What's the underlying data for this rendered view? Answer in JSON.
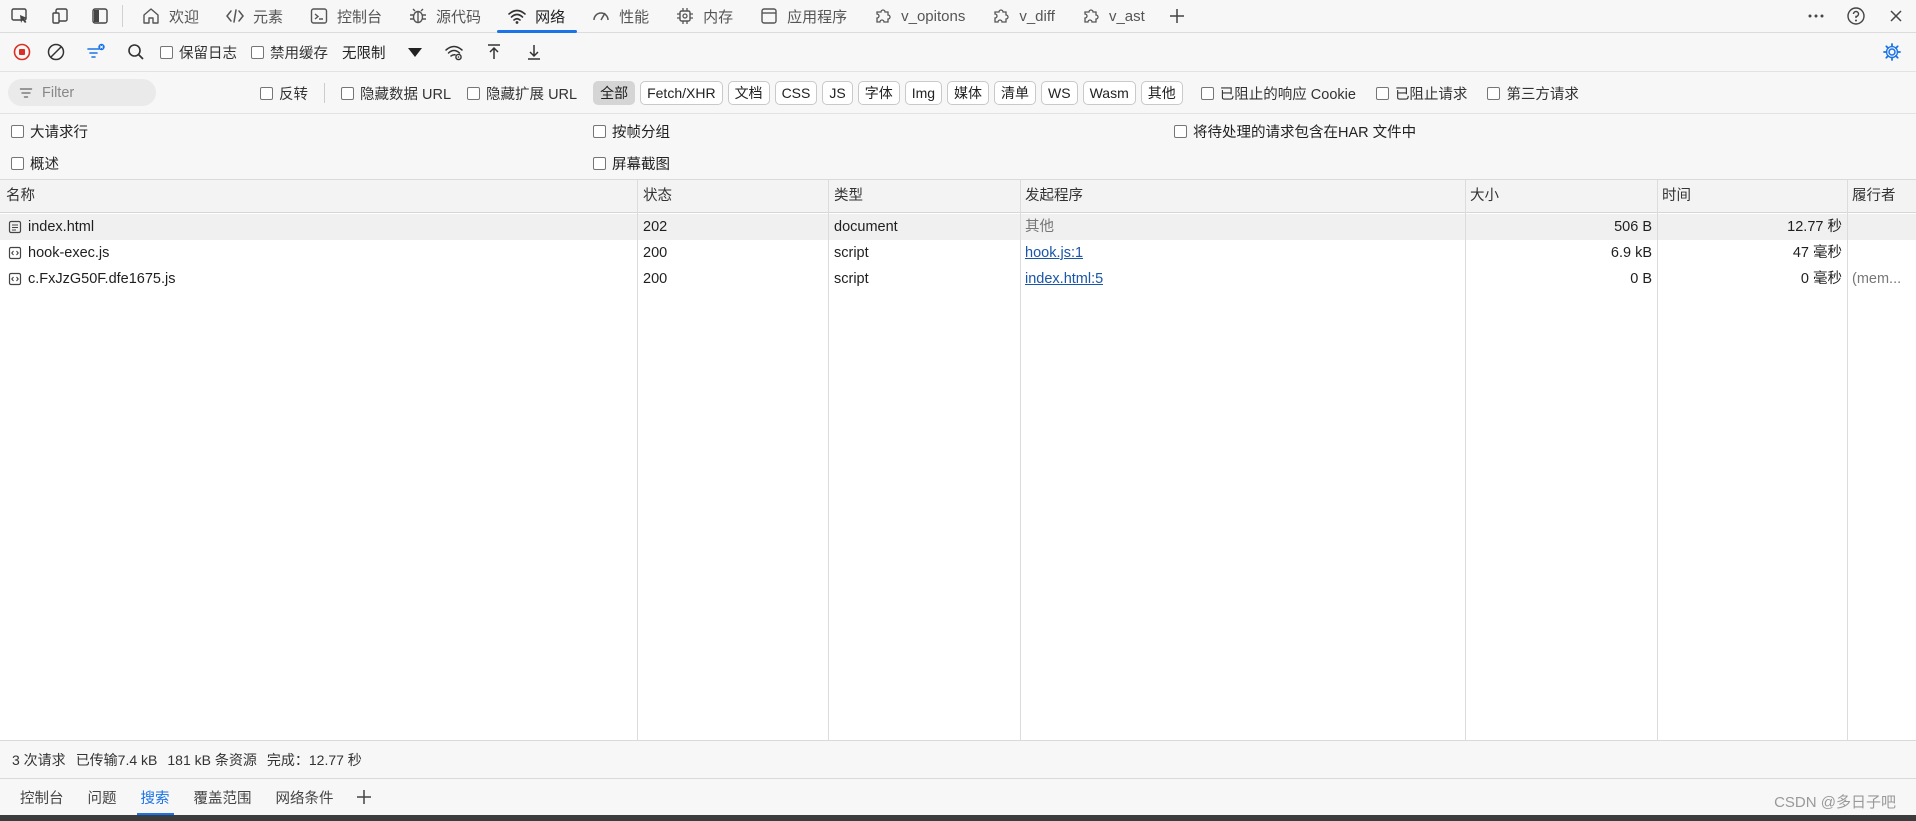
{
  "top_tabs": {
    "tabs": [
      {
        "label": "欢迎",
        "icon": "home-icon",
        "active": false
      },
      {
        "label": "元素",
        "icon": "code-icon",
        "active": false
      },
      {
        "label": "控制台",
        "icon": "console-icon",
        "active": false
      },
      {
        "label": "源代码",
        "icon": "bug-icon",
        "active": false
      },
      {
        "label": "网络",
        "icon": "wifi-icon",
        "active": true
      },
      {
        "label": "性能",
        "icon": "gauge-icon",
        "active": false
      },
      {
        "label": "内存",
        "icon": "chip-icon",
        "active": false
      },
      {
        "label": "应用程序",
        "icon": "app-window-icon",
        "active": false
      },
      {
        "label": "v_opitons",
        "icon": "puzzle-icon",
        "active": false
      },
      {
        "label": "v_diff",
        "icon": "puzzle-icon",
        "active": false
      },
      {
        "label": "v_ast",
        "icon": "puzzle-icon",
        "active": false
      }
    ]
  },
  "toolbar": {
    "preserve_log_label": "保留日志",
    "disable_cache_label": "禁用缓存",
    "throttle_value": "无限制"
  },
  "filter": {
    "placeholder": "Filter",
    "invert_label": "反转",
    "hide_data_url_label": "隐藏数据 URL",
    "hide_ext_url_label": "隐藏扩展 URL",
    "type_chips": [
      "全部",
      "Fetch/XHR",
      "文档",
      "CSS",
      "JS",
      "字体",
      "Img",
      "媒体",
      "清单",
      "WS",
      "Wasm",
      "其他"
    ],
    "blocked_cookie_label": "已阻止的响应 Cookie",
    "blocked_requests_label": "已阻止请求",
    "third_party_label": "第三方请求"
  },
  "options": {
    "big_rows": "大请求行",
    "overview": "概述",
    "group_by_frame": "按帧分组",
    "screenshots": "屏幕截图",
    "har_pending": "将待处理的请求包含在HAR 文件中"
  },
  "table": {
    "headers": {
      "name": "名称",
      "status": "状态",
      "type": "类型",
      "initiator": "发起程序",
      "size": "大小",
      "time": "时间",
      "fulfilled_by": "履行者"
    },
    "rows": [
      {
        "name": "index.html",
        "status": "202",
        "type": "document",
        "initiator": "其他",
        "size": "506 B",
        "time": "12.77 秒",
        "fulfilled_by": ""
      },
      {
        "name": "hook-exec.js",
        "status": "200",
        "type": "script",
        "initiator": "hook.js:1",
        "size": "6.9 kB",
        "time": "47  毫秒",
        "fulfilled_by": ""
      },
      {
        "name": "c.FxJzG50F.dfe1675.js",
        "status": "200",
        "type": "script",
        "initiator": "index.html:5",
        "size": "0 B",
        "time": "0  毫秒",
        "fulfilled_by": "(mem..."
      }
    ]
  },
  "status": {
    "requests": "3 次请求",
    "transferred": "已传输7.4 kB",
    "resources": "181 kB 条资源",
    "finish": "完成：12.77 秒"
  },
  "drawer": {
    "tabs": [
      {
        "label": "控制台",
        "active": false
      },
      {
        "label": "问题",
        "active": false
      },
      {
        "label": "搜索",
        "active": true
      },
      {
        "label": "覆盖范围",
        "active": false
      },
      {
        "label": "网络条件",
        "active": false
      }
    ],
    "watermark": "CSDN @多日子吧"
  },
  "colors": {
    "accent": "#1a73e8",
    "record_red": "#d93025",
    "link": "#1a56a7"
  }
}
